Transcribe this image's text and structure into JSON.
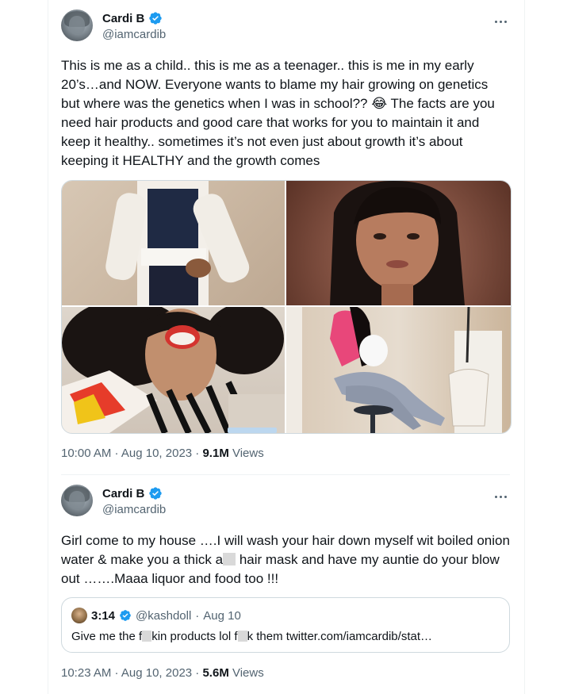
{
  "tweet1": {
    "name": "Cardi B",
    "handle": "@iamcardib",
    "text": "This is me as a child.. this is me as a teenager.. this is me in my early 20’s…and NOW. Everyone wants to blame my hair growing on genetics but where was the genetics when I was in school?? 😂 The facts are you need hair products and good care that works for you to maintain it and keep it healthy.. sometimes it’s not even just about growth it’s about keeping it HEALTHY and the growth comes",
    "time": "10:00 AM · Aug 10, 2023 · ",
    "views_count": "9.1M",
    "views_label": " Views",
    "media": [
      "photo-child",
      "photo-teenager",
      "photo-early-20s",
      "photo-now"
    ]
  },
  "tweet2": {
    "name": "Cardi B",
    "handle": "@iamcardib",
    "text_part1": "Girl come to my house ….I will wash your hair down myself wit boiled onion water & make you a thick a",
    "text_part2": " hair mask and have my auntie do your blow out …….Maaa liquor and food too !!!",
    "time": "10:23 AM · Aug 10, 2023 · ",
    "views_count": "5.6M",
    "views_label": " Views"
  },
  "quote": {
    "name": "3:14",
    "handle": "@kashdoll",
    "separator": "·",
    "date": "Aug 10",
    "text_a": "Give me the f",
    "text_b": "kin products lol f",
    "text_c": "k them twitter.com/iamcardib/stat…"
  },
  "colors": {
    "verified": "#1d9bf0",
    "muted": "#536471",
    "text": "#0f1419"
  }
}
